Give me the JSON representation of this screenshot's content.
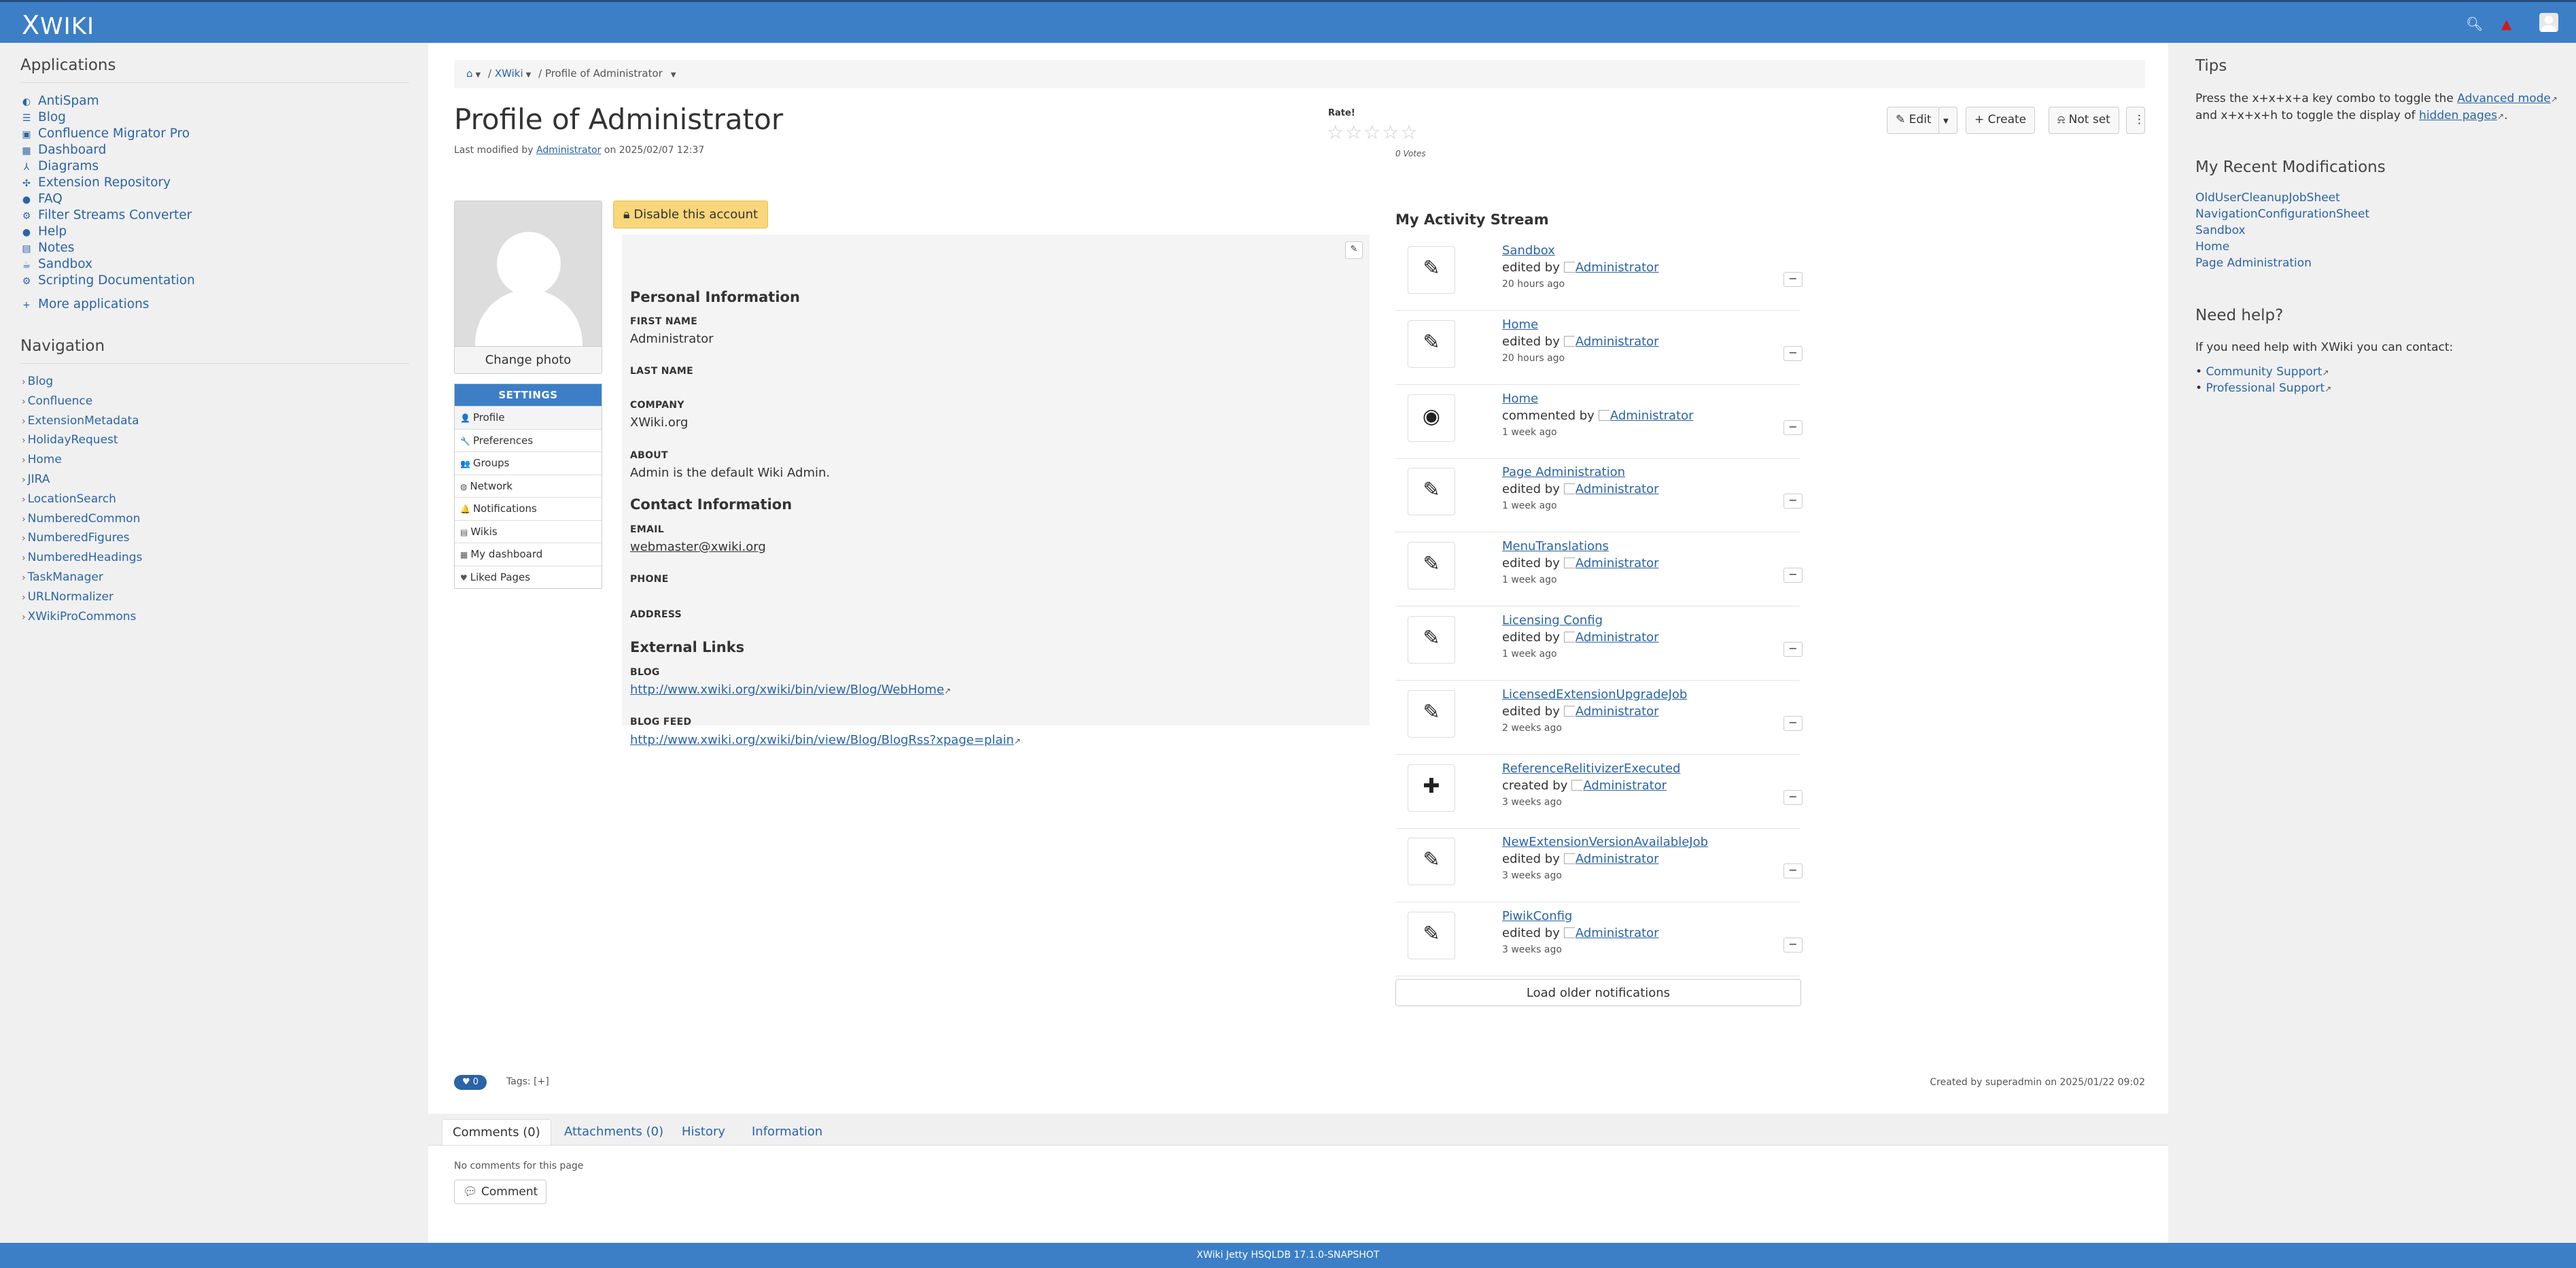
{
  "topbar": {
    "logo": "WIKI",
    "logo_x": "X",
    "search_icon": "search-icon",
    "bell_icon": "bell-icon"
  },
  "left_panel": {
    "applications_heading": "Applications",
    "applications": [
      {
        "label": "AntiSpam",
        "icon": "shield-icon",
        "glyph": "◐"
      },
      {
        "label": "Blog",
        "icon": "rss-icon",
        "glyph": "☰"
      },
      {
        "label": "Confluence Migrator Pro",
        "icon": "clipboard-icon",
        "glyph": "▣"
      },
      {
        "label": "Dashboard",
        "icon": "grid-icon",
        "glyph": "▦"
      },
      {
        "label": "Diagrams",
        "icon": "diagram-icon",
        "glyph": "⅄"
      },
      {
        "label": "Extension Repository",
        "icon": "puzzle-icon",
        "glyph": "✣"
      },
      {
        "label": "FAQ",
        "icon": "question-icon",
        "glyph": "●"
      },
      {
        "label": "Filter Streams Converter",
        "icon": "gears-icon",
        "glyph": "⚙"
      },
      {
        "label": "Help",
        "icon": "help-icon",
        "glyph": "●"
      },
      {
        "label": "Notes",
        "icon": "note-icon",
        "glyph": "▤"
      },
      {
        "label": "Sandbox",
        "icon": "cup-icon",
        "glyph": "☕"
      },
      {
        "label": "Scripting Documentation",
        "icon": "code-icon",
        "glyph": "⚙"
      }
    ],
    "more_apps": "More applications",
    "navigation_heading": "Navigation",
    "navigation": [
      "Blog",
      "Confluence",
      "ExtensionMetadata",
      "HolidayRequest",
      "Home",
      "JIRA",
      "LocationSearch",
      "NumberedCommon",
      "NumberedFigures",
      "NumberedHeadings",
      "TaskManager",
      "URLNormalizer",
      "XWikiProCommons"
    ]
  },
  "breadcrumb": {
    "home_icon": "home-icon",
    "space": "XWiki",
    "current": "Profile of Administrator"
  },
  "page": {
    "title": "Profile of Administrator",
    "last_modified_prefix": "Last modified by",
    "last_modified_user": "Administrator",
    "last_modified_suffix": "on 2025/02/07 12:37"
  },
  "rating": {
    "label": "Rate!",
    "stars": "☆☆☆☆☆",
    "votes": "0 Votes"
  },
  "toolbar": {
    "edit": "Edit",
    "create": "Create",
    "watch": "Not set"
  },
  "profile": {
    "change_photo": "Change photo",
    "disable_account": "Disable this account",
    "settings_heading": "SETTINGS",
    "settings_items": [
      {
        "label": "Profile",
        "icon": "user-icon",
        "glyph": "👤"
      },
      {
        "label": "Preferences",
        "icon": "wrench-icon",
        "glyph": "🔧"
      },
      {
        "label": "Groups",
        "icon": "group-icon",
        "glyph": "👥"
      },
      {
        "label": "Network",
        "icon": "globe-icon",
        "glyph": "◍"
      },
      {
        "label": "Notifications",
        "icon": "bell-icon",
        "glyph": "🔔"
      },
      {
        "label": "Wikis",
        "icon": "list-icon",
        "glyph": "▤"
      },
      {
        "label": "My dashboard",
        "icon": "grid-icon",
        "glyph": "▦"
      },
      {
        "label": "Liked Pages",
        "icon": "heart-icon",
        "glyph": "♥"
      }
    ],
    "personal_heading": "Personal Information",
    "first_name_label": "FIRST NAME",
    "first_name": "Administrator",
    "last_name_label": "LAST NAME",
    "company_label": "COMPANY",
    "company": "XWiki.org",
    "about_label": "ABOUT",
    "about": "Admin is the default Wiki Admin.",
    "contact_heading": "Contact Information",
    "email_label": "EMAIL",
    "email": "webmaster@xwiki.org",
    "phone_label": "PHONE",
    "address_label": "ADDRESS",
    "links_heading": "External Links",
    "blog_label": "BLOG",
    "blog": "http://www.xwiki.org/xwiki/bin/view/Blog/WebHome",
    "blogfeed_label": "BLOG FEED",
    "blogfeed": "http://www.xwiki.org/xwiki/bin/view/Blog/BlogRss?xpage=plain"
  },
  "activity": {
    "title": "My Activity Stream",
    "items": [
      {
        "page": "Sandbox",
        "action": "edited by",
        "user": "Administrator",
        "time": "20 hours ago",
        "icon": "pencil-icon"
      },
      {
        "page": "Home",
        "action": "edited by",
        "user": "Administrator",
        "time": "20 hours ago",
        "icon": "pencil-icon"
      },
      {
        "page": "Home",
        "action": "commented by",
        "user": "Administrator",
        "time": "1 week ago",
        "icon": "comments-icon"
      },
      {
        "page": "Page Administration",
        "action": "edited by",
        "user": "Administrator",
        "time": "1 week ago",
        "icon": "pencil-icon"
      },
      {
        "page": "MenuTranslations",
        "action": "edited by",
        "user": "Administrator",
        "time": "1 week ago",
        "icon": "pencil-icon"
      },
      {
        "page": "Licensing Config",
        "action": "edited by",
        "user": "Administrator",
        "time": "1 week ago",
        "icon": "pencil-icon"
      },
      {
        "page": "LicensedExtensionUpgradeJob",
        "action": "edited by",
        "user": "Administrator",
        "time": "2 weeks ago",
        "icon": "pencil-icon"
      },
      {
        "page": "ReferenceRelitivizerExecuted",
        "action": "created by",
        "user": "Administrator",
        "time": "3 weeks ago",
        "icon": "plus-icon"
      },
      {
        "page": "NewExtensionVersionAvailableJob",
        "action": "edited by",
        "user": "Administrator",
        "time": "3 weeks ago",
        "icon": "pencil-icon"
      },
      {
        "page": "PiwikConfig",
        "action": "edited by",
        "user": "Administrator",
        "time": "3 weeks ago",
        "icon": "pencil-icon"
      }
    ],
    "load_older": "Load older notifications"
  },
  "page_footer": {
    "likes": "0",
    "tags": "Tags: [+]",
    "created": "Created by superadmin on 2025/01/22 09:02",
    "tabs": [
      "Comments (0)",
      "Attachments (0)",
      "History",
      "Information"
    ],
    "no_comments": "No comments for this page",
    "comment_button": "Comment"
  },
  "right_panel": {
    "tips_heading": "Tips",
    "tips_text_1": "Press the x+x+x+a key combo to toggle the",
    "tips_link_1": "Advanced mode",
    "tips_text_2": "and x+x+x+h to toggle the display of",
    "tips_link_2": "hidden pages",
    "recent_heading": "My Recent Modifications",
    "recent": [
      "OldUserCleanupJobSheet",
      "NavigationConfigurationSheet",
      "Sandbox",
      "Home",
      "Page Administration"
    ],
    "help_heading": "Need help?",
    "help_text": "If you need help with XWiki you can contact:",
    "help_links": [
      "Community Support",
      "Professional Support"
    ]
  },
  "footer": {
    "text": "XWiki Jetty HSQLDB 17.1.0-SNAPSHOT"
  }
}
